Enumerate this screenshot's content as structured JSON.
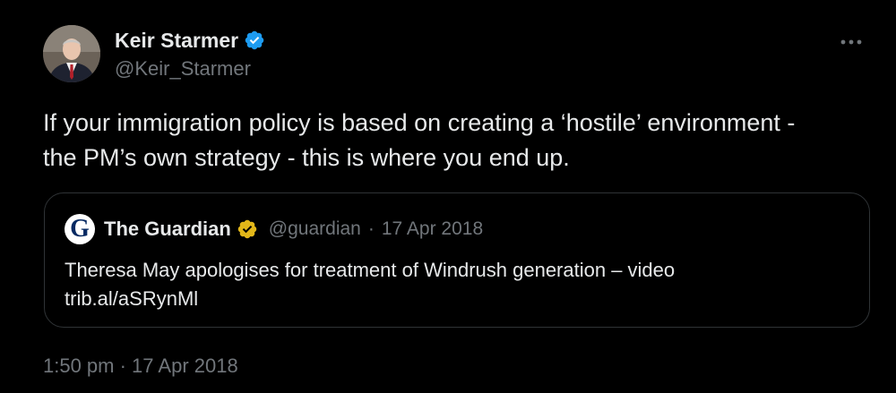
{
  "tweet": {
    "author_name": "Keir Starmer",
    "author_handle": "@Keir_Starmer",
    "text": "If your immigration policy is based on creating a ‘hostile’ environment -\nthe PM’s own strategy - this is where you end up.",
    "timestamp": "1:50 pm · 17 Apr 2018",
    "more_icon": "more-horizontal-icon",
    "verified_color": "#1d9bf0"
  },
  "quote": {
    "logo_letter": "G",
    "name": "The Guardian",
    "handle": "@guardian",
    "separator": "·",
    "date": "17 Apr 2018",
    "line1": "Theresa May apologises for treatment of Windrush generation – video",
    "line2": "trib.al/aSRynMl",
    "verified_color": "#e2b719"
  }
}
